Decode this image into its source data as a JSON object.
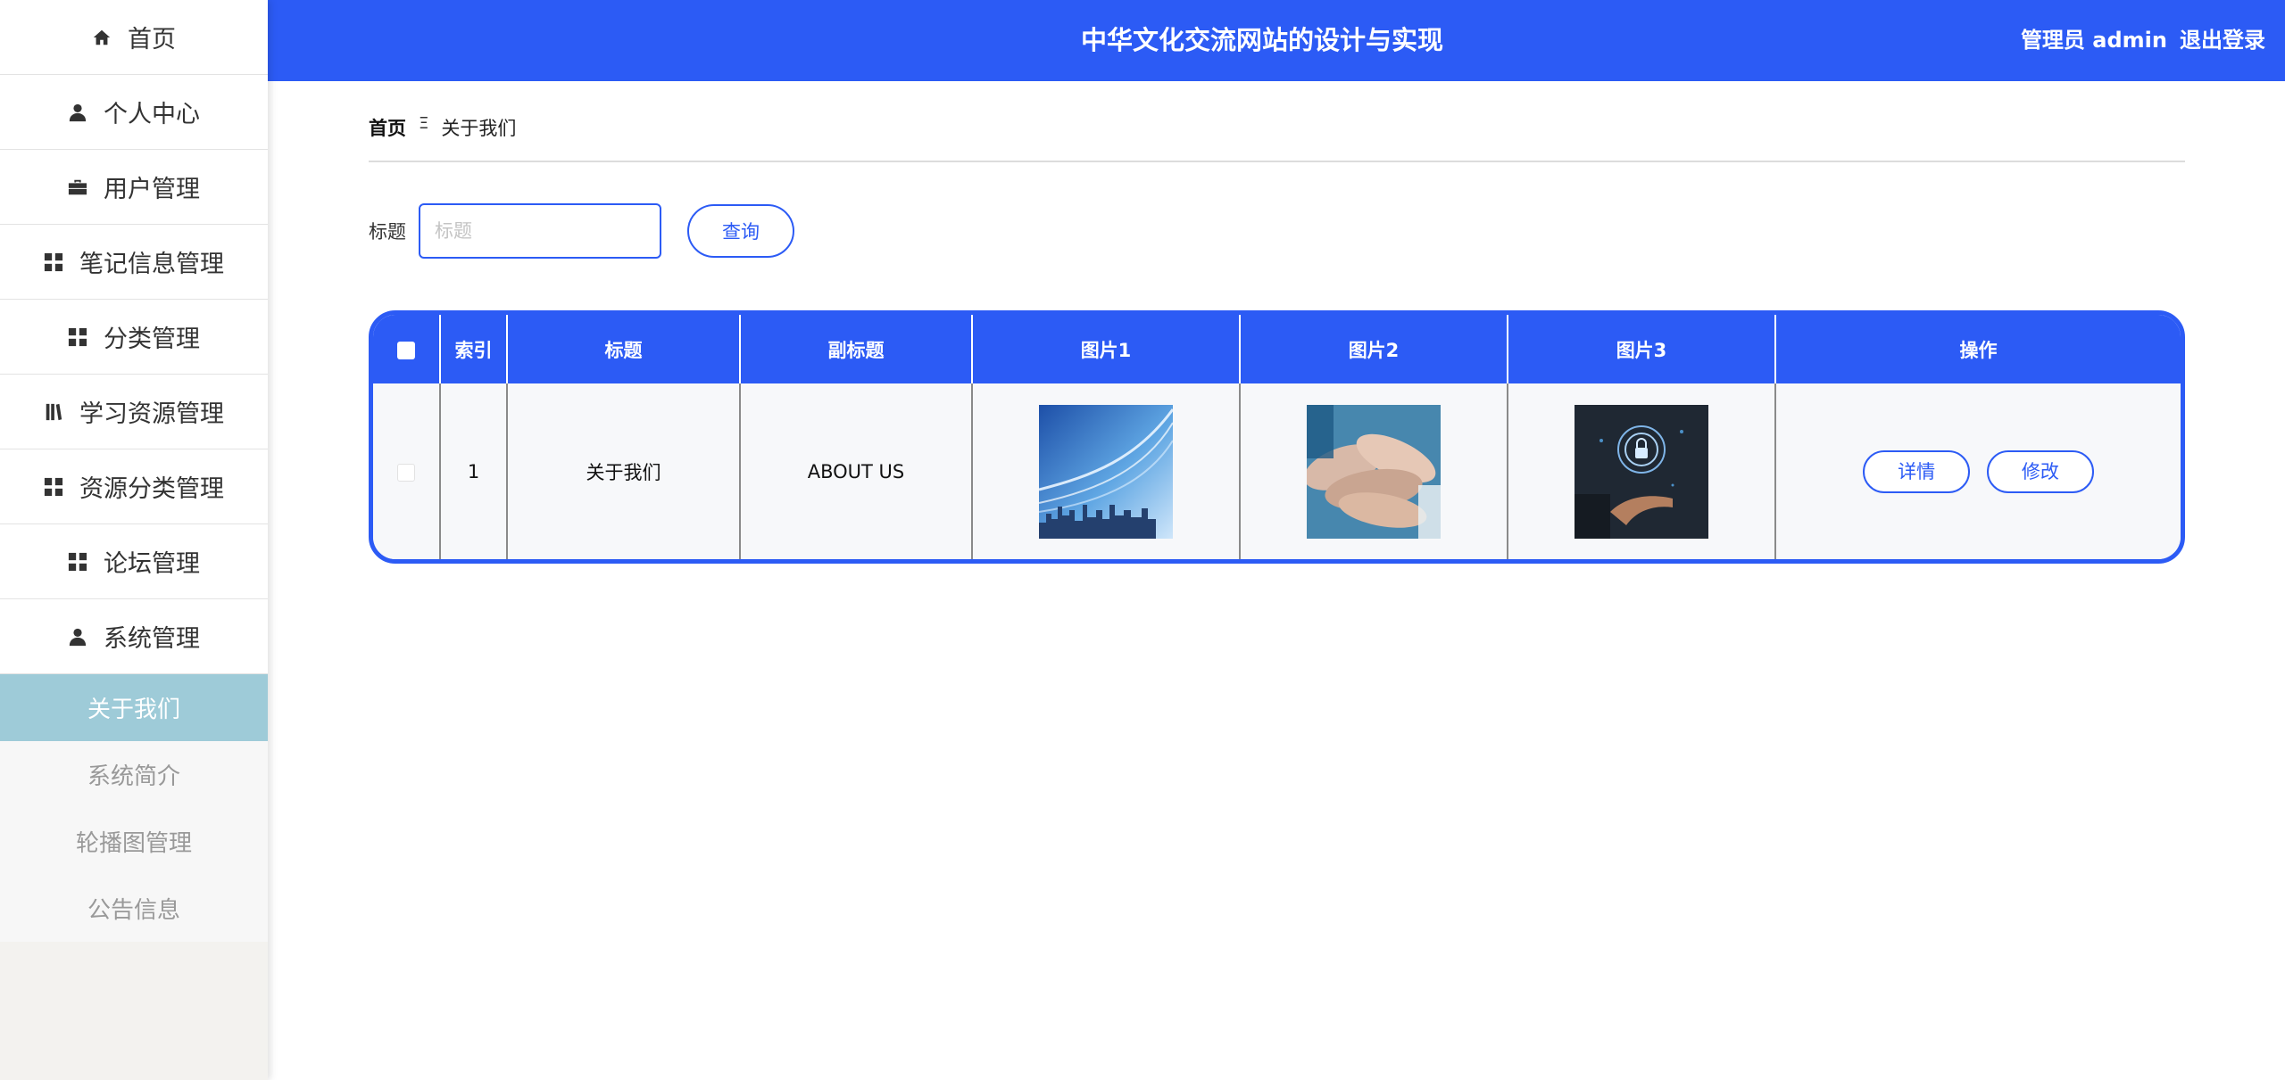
{
  "sidebar": {
    "items": [
      {
        "label": "首页",
        "icon": "home-icon"
      },
      {
        "label": "个人中心",
        "icon": "user-icon"
      },
      {
        "label": "用户管理",
        "icon": "briefcase-icon"
      },
      {
        "label": "笔记信息管理",
        "icon": "grid-icon"
      },
      {
        "label": "分类管理",
        "icon": "grid-icon"
      },
      {
        "label": "学习资源管理",
        "icon": "book-icon"
      },
      {
        "label": "资源分类管理",
        "icon": "grid-icon"
      },
      {
        "label": "论坛管理",
        "icon": "grid-icon"
      },
      {
        "label": "系统管理",
        "icon": "user-icon"
      }
    ],
    "submenu": [
      {
        "label": "关于我们",
        "active": true
      },
      {
        "label": "系统简介",
        "active": false
      },
      {
        "label": "轮播图管理",
        "active": false
      },
      {
        "label": "公告信息",
        "active": false
      }
    ]
  },
  "header": {
    "title": "中华文化交流网站的设计与实现",
    "user": "管理员 admin",
    "logout": "退出登录"
  },
  "breadcrumb": {
    "home": "首页",
    "separator": "Ξ",
    "current": "关于我们"
  },
  "search": {
    "label": "标题",
    "placeholder": "标题",
    "value": "",
    "button": "查询"
  },
  "table": {
    "headers": [
      "索引",
      "标题",
      "副标题",
      "图片1",
      "图片2",
      "图片3",
      "操作"
    ],
    "rows": [
      {
        "index": "1",
        "title": "关于我们",
        "subtitle": "ABOUT US",
        "images": [
          "city-skyline-image",
          "stacked-hands-image",
          "lock-in-hand-image"
        ]
      }
    ],
    "actions": {
      "detail": "详情",
      "edit": "修改"
    }
  },
  "colors": {
    "primary": "#2c5bf5",
    "submenu_active": "#9ecbd8",
    "sidebar_bg": "#f3f2ef"
  }
}
